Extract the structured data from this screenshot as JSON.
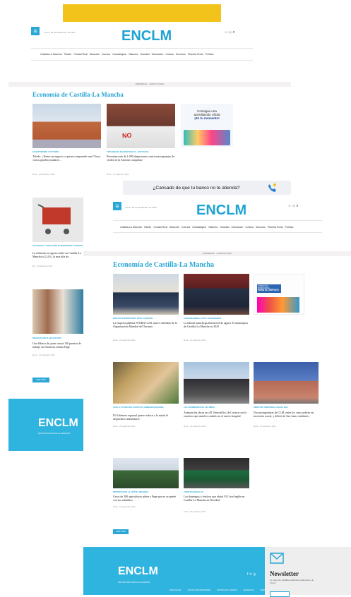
{
  "site": {
    "logo_text": "ENCLM",
    "logo_tagline": "NOTICIAS DE CASTILLA-LA MANCHA",
    "search_placeholder": "Lunes, 23 de septiembre de 2024",
    "nav_items": [
      "Castilla-La Mancha",
      "Toledo",
      "Ciudad Real",
      "Albacete",
      "Cuenca",
      "Guadalajara",
      "Talavera",
      "Sanidad",
      "Educación",
      "Cultura",
      "Sucesos",
      "Planeta Rural",
      "Política"
    ],
    "subnav": [
      "EMPRESAS",
      "AGRICULTURA"
    ],
    "section_title": "Economía de Castilla-La Mancha",
    "more_button": "VER MÁS",
    "footer_tagline": "NOTICIAS DE CASTILLA-LA MANCHA",
    "footer_links": [
      "AVISO LEGAL",
      "POLÍTICA DE PRIVACIDAD",
      "POLÍTICA DE COOKIES",
      "ANUNCIÁTE",
      "CONTACTO"
    ]
  },
  "banner": {
    "ad_text": "¿Cansado de que tu banco no te atienda?",
    "ad_promo_line1": "Consigue una",
    "ad_promo_line2": "acreditación oficial",
    "ad_promo_line3": "¡Es tu momento!"
  },
  "page1": {
    "articles": [
      {
        "cat": "EN SEPTIEMBRE Y OCTUBRE",
        "headline": "Toledo: ¿Tienes un negocio o quieres emprender uno? Estos cursos pueden ayudarte…",
        "meta": "Enclm · 23 septiembre 2024"
      },
      {
        "cat": "TRES NUEVAS MACROGRANJAS · AFECTADAS",
        "headline": "Presentan más de 1.000 alegaciones contra macrogranjas de cerdos en la Alcarria conquense",
        "meta": "Enclm · 23 septiembre 2024"
      },
      {
        "cat": "EN AGOSTO, LA INFLACIÓN SE MODERÓ EN LA REGIÓN",
        "headline": "La inflación en agosto subió en Castilla-La Mancha al 2,4 %, la más alta de…",
        "meta": "Efe · 13 septiembre 2024"
      },
      {
        "cat": "PARADAS POR PLAZAS DE 2025",
        "headline": "Una fábrica de, pone creará 150 puestos de trabajo en Tarancón, afirma Page",
        "meta": "Enclm · 13 septiembre 2024"
      }
    ]
  },
  "page2": {
    "promo": {
      "line1": "FORMACIÓN PROFESIONAL",
      "line2": "PARA EL EMPLEO"
    },
    "articles": [
      {
        "cat": "EMPLEO INTERNACIONAL PARA LA REGIÓN",
        "headline": "La empresa pública STORA CLM, nuevo miembro de la Organización Mundial del Turismo",
        "meta": "Enclm · 20 septiembre 2024"
      },
      {
        "cat": "CONSUMO MEDIO, ESTO Y SUSPENDIDOS",
        "headline": "La tubería manchega abastecerá de agua a 35 municipios de Castilla-La Mancha en 2025",
        "meta": "Enclm · 20 septiembre 2024"
      },
      {
        "cat": "CON LA COTIZACIÓN, CARTAS AL GOBIERNO REGIONAL",
        "headline": "El Gobierno regional quiere reducir a la mitad el desperdicio alimentario",
        "meta": "Enclm · 20 septiembre 2024"
      },
      {
        "cat": "LOS CORREDORES DE LOS NIÑOS",
        "headline": "Avanzan las obras en «El Ventorrillo» de Cuenca con la carretera que unirá la ciudad con el nuevo hospital",
        "meta": "Enclm · 20 septiembre 2024"
      },
      {
        "cat": "DIRECTOR TERRITORIAL SOCIAL 2024",
        "headline": "Dos protagonistas de CLM, entre los cinco pobres en inversión social, y déficit de San Juan, residentes",
        "meta": "Enclm · 19 septiembre 2024"
      },
      {
        "cat": "PROTESTAN EN LA CAPITAL REGIONAL",
        "headline": "Cerca de 200 agricultores piden a Page que no se quede con sus subsidios",
        "meta": "Enclm · 18 septiembre 2024"
      },
      {
        "cat": "CONSULTA REGULAR",
        "headline": "Los domingos y festivos que abrirá El Corte Inglés en Castilla-La Mancha en Navidad",
        "meta": "Enclm · 18 septiembre 2024"
      }
    ]
  },
  "newsletter": {
    "title": "Newsletter",
    "text": "Lo mejor de Castilla-La Mancha cada día en tu correo"
  },
  "colors": {
    "accent": "#2aa7d6",
    "footer": "#2fb3df",
    "banner": "#f2c31b"
  }
}
